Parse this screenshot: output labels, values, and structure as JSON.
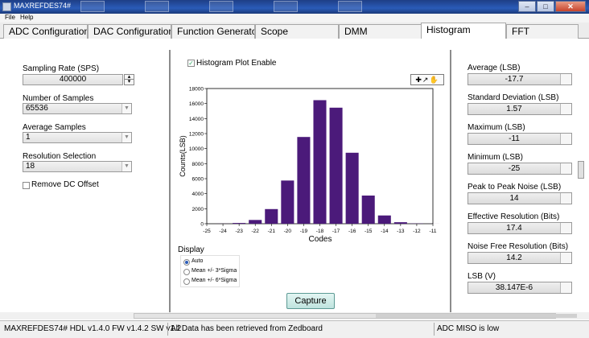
{
  "window": {
    "title": "MAXREFDES74#"
  },
  "menu": [
    "File",
    "Help"
  ],
  "tabs": [
    "ADC Configuration",
    "DAC Configuration",
    "Function Generator",
    "Scope",
    "DMM",
    "Histogram",
    "FFT"
  ],
  "left": {
    "sampling_rate_label": "Sampling Rate (SPS)",
    "sampling_rate_value": "400000",
    "num_samples_label": "Number of Samples",
    "num_samples_value": "65536",
    "avg_samples_label": "Average Samples",
    "avg_samples_value": "1",
    "resolution_label": "Resolution Selection",
    "resolution_value": "18",
    "remove_dc_label": "Remove DC Offset"
  },
  "center": {
    "histogram_enable_label": "Histogram Plot Enable",
    "display_label": "Display",
    "display_options": [
      "Auto",
      "Mean +/- 3*Sigma",
      "Mean +/- 6*Sigma"
    ],
    "capture_label": "Capture"
  },
  "chart_data": {
    "type": "bar",
    "xlabel": "Codes",
    "ylabel": "Counts(LSB)",
    "x": [
      -25,
      -24,
      -23,
      -22,
      -21,
      -20,
      -19,
      -18,
      -17,
      -16,
      -15,
      -14,
      -13,
      -12,
      -11
    ],
    "values": [
      0,
      10,
      100,
      500,
      1950,
      5750,
      11550,
      16450,
      15450,
      9450,
      3750,
      1100,
      200,
      30,
      5
    ],
    "xlim": [
      -25,
      -11
    ],
    "ylim": [
      0,
      18000
    ],
    "yticks": [
      0,
      2000,
      4000,
      6000,
      8000,
      10000,
      12000,
      14000,
      16000,
      18000
    ],
    "color": "#4b1a7a"
  },
  "right": [
    {
      "label": "Average (LSB)",
      "value": "-17.7"
    },
    {
      "label": "Standard Deviation (LSB)",
      "value": "1.57"
    },
    {
      "label": "Maximum (LSB)",
      "value": "-11"
    },
    {
      "label": "Minimum (LSB)",
      "value": "-25"
    },
    {
      "label": "Peak to Peak Noise (LSB)",
      "value": "14"
    },
    {
      "label": "Effective Resolution (Bits)",
      "value": "17.4"
    },
    {
      "label": "Noise Free Resolution (Bits)",
      "value": "14.2"
    },
    {
      "label": "LSB (V)",
      "value": "38.147E-6"
    }
  ],
  "status": {
    "version": "MAXREFDES74# HDL v1.4.0 FW v1.4.2 SW v1.2",
    "message": "All Data has been retrieved from Zedboard",
    "miso": "ADC MISO is low"
  }
}
